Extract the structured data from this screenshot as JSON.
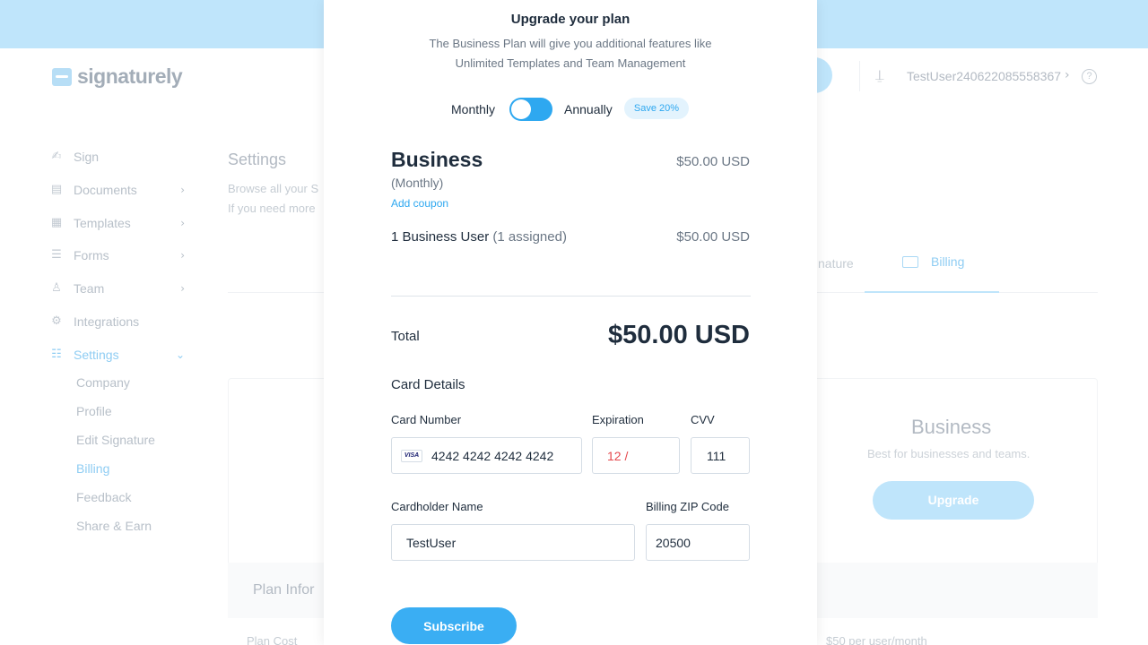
{
  "header": {
    "logo_text": "signaturely",
    "user_name": "TestUser240622085558367",
    "user_chevron": "›",
    "help_glyph": "?"
  },
  "sidebar": {
    "items": [
      {
        "label": "Sign",
        "icon": "signature-icon",
        "glyph": "✍"
      },
      {
        "label": "Documents",
        "icon": "document-icon",
        "glyph": "▤",
        "chevron": "›"
      },
      {
        "label": "Templates",
        "icon": "template-icon",
        "glyph": "▦",
        "chevron": "›"
      },
      {
        "label": "Forms",
        "icon": "form-icon",
        "glyph": "☰",
        "chevron": "›"
      },
      {
        "label": "Team",
        "icon": "team-icon",
        "glyph": "♙",
        "chevron": "›"
      },
      {
        "label": "Integrations",
        "icon": "gear-icon",
        "glyph": "⚙"
      },
      {
        "label": "Settings",
        "icon": "sliders-icon",
        "glyph": "☷",
        "chevron": "⌄"
      }
    ],
    "settings_sub": [
      "Company",
      "Profile",
      "Edit Signature",
      "Billing",
      "Feedback",
      "Share & Earn"
    ]
  },
  "page": {
    "title": "Settings",
    "desc_line1": "Browse all your S",
    "desc_line2": "If you need more",
    "tab_signature": "nature",
    "tab_billing": "Billing",
    "plan_name": "Business",
    "plan_subtitle": "Best for businesses and teams.",
    "upgrade_label": "Upgrade",
    "plan_info_title": "Plan Infor",
    "plan_cost_label": "Plan Cost",
    "plan_cost_value": "$50 per user/month"
  },
  "modal": {
    "title": "Upgrade your plan",
    "desc_line1": "The Business Plan will give you additional features like",
    "desc_line2": "Unlimited Templates and Team Management",
    "toggle": {
      "monthly": "Monthly",
      "annually": "Annually",
      "save_badge": "Save 20%"
    },
    "plan": {
      "name": "Business",
      "price": "$50.00 USD",
      "period": "(Monthly)",
      "add_coupon": "Add coupon",
      "users_label": "1 Business User",
      "users_assigned": "(1 assigned)",
      "users_price": "$50.00 USD"
    },
    "total_label": "Total",
    "total_value": "$50.00 USD",
    "card_details_title": "Card Details",
    "fields": {
      "card_number_label": "Card Number",
      "card_brand": "VISA",
      "card_number": "4242 4242 4242 4242",
      "expiration_label": "Expiration",
      "expiration_value": "12 /",
      "cvv_label": "CVV",
      "cvv_value": "111",
      "cardholder_label": "Cardholder Name",
      "cardholder_value": "TestUser",
      "zip_label": "Billing ZIP Code",
      "zip_value": "20500"
    },
    "subscribe_label": "Subscribe"
  },
  "colors": {
    "accent": "#2ea8f0",
    "banner": "#bfe5fb",
    "error": "#e5484d"
  }
}
